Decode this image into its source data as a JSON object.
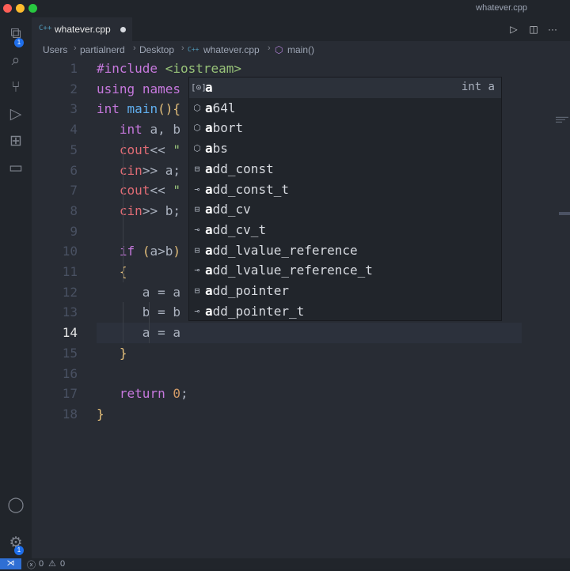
{
  "window": {
    "title": "whatever.cpp"
  },
  "colors": {
    "accent": "#1f6feb",
    "keyword": "#c678dd",
    "string": "#98c379",
    "number": "#d19a66",
    "variable": "#e06c75"
  },
  "activity_bar": {
    "items": [
      {
        "name": "explorer-icon",
        "glyph": "⧉",
        "badge": "1"
      },
      {
        "name": "search-icon",
        "glyph": "⌕"
      },
      {
        "name": "source-control-icon",
        "glyph": "⑂"
      },
      {
        "name": "run-debug-icon",
        "glyph": "▷"
      },
      {
        "name": "extensions-icon",
        "glyph": "⊞"
      },
      {
        "name": "remote-explorer-icon",
        "glyph": "▭"
      }
    ],
    "bottom": [
      {
        "name": "account-icon",
        "glyph": "◯"
      },
      {
        "name": "manage-gear-icon",
        "glyph": "⚙",
        "badge": "1"
      }
    ]
  },
  "tab": {
    "icon": "C++",
    "label": "whatever.cpp",
    "modified": true
  },
  "breadcrumb": {
    "items": [
      "Users",
      "partialnerd",
      "Desktop",
      "whatever.cpp",
      "main()"
    ],
    "separator": "›",
    "file_icon": "C++",
    "symbol_icon": "⬡"
  },
  "editor": {
    "active_line": "14",
    "lines": [
      {
        "n": "1",
        "text": "#include <iostream>"
      },
      {
        "n": "2",
        "text": "using names"
      },
      {
        "n": "3",
        "text": "int main(){"
      },
      {
        "n": "4",
        "text": "   int a, b"
      },
      {
        "n": "5",
        "text": "   cout<< \""
      },
      {
        "n": "6",
        "text": "   cin>> a;"
      },
      {
        "n": "7",
        "text": "   cout<< \""
      },
      {
        "n": "8",
        "text": "   cin>> b;"
      },
      {
        "n": "9",
        "text": ""
      },
      {
        "n": "10",
        "text": "   if (a>b)"
      },
      {
        "n": "11",
        "text": "   {"
      },
      {
        "n": "12",
        "text": "      a = a"
      },
      {
        "n": "13",
        "text": "      b = b"
      },
      {
        "n": "14",
        "text": "      a = a"
      },
      {
        "n": "15",
        "text": "   }"
      },
      {
        "n": "16",
        "text": ""
      },
      {
        "n": "17",
        "text": "   return 0;"
      },
      {
        "n": "18",
        "text": "}"
      }
    ]
  },
  "suggestions": {
    "typed": "a",
    "items": [
      {
        "icon": "[⊙]",
        "prefix": "a",
        "rest": "",
        "detail": "int a",
        "kind": "variable"
      },
      {
        "icon": "⬡",
        "prefix": "a",
        "rest": "64l",
        "kind": "method"
      },
      {
        "icon": "⬡",
        "prefix": "a",
        "rest": "bort",
        "kind": "method"
      },
      {
        "icon": "⬡",
        "prefix": "a",
        "rest": "bs",
        "kind": "method"
      },
      {
        "icon": "⊟",
        "prefix": "a",
        "rest": "dd_const",
        "kind": "struct"
      },
      {
        "icon": "⊸",
        "prefix": "a",
        "rest": "dd_const_t",
        "kind": "typedef"
      },
      {
        "icon": "⊟",
        "prefix": "a",
        "rest": "dd_cv",
        "kind": "struct"
      },
      {
        "icon": "⊸",
        "prefix": "a",
        "rest": "dd_cv_t",
        "kind": "typedef"
      },
      {
        "icon": "⊟",
        "prefix": "a",
        "rest": "dd_lvalue_reference",
        "kind": "struct"
      },
      {
        "icon": "⊸",
        "prefix": "a",
        "rest": "dd_lvalue_reference_t",
        "kind": "typedef"
      },
      {
        "icon": "⊟",
        "prefix": "a",
        "rest": "dd_pointer",
        "kind": "struct"
      },
      {
        "icon": "⊸",
        "prefix": "a",
        "rest": "dd_pointer_t",
        "kind": "typedef"
      }
    ]
  },
  "status_bar": {
    "remote_icon": "⋊",
    "errors": "0",
    "warnings": "0",
    "error_icon": "ⓧ",
    "warning_icon": "⚠"
  },
  "toolbar": {
    "run_icon": "▷",
    "split_icon": "◫",
    "more_icon": "···"
  }
}
